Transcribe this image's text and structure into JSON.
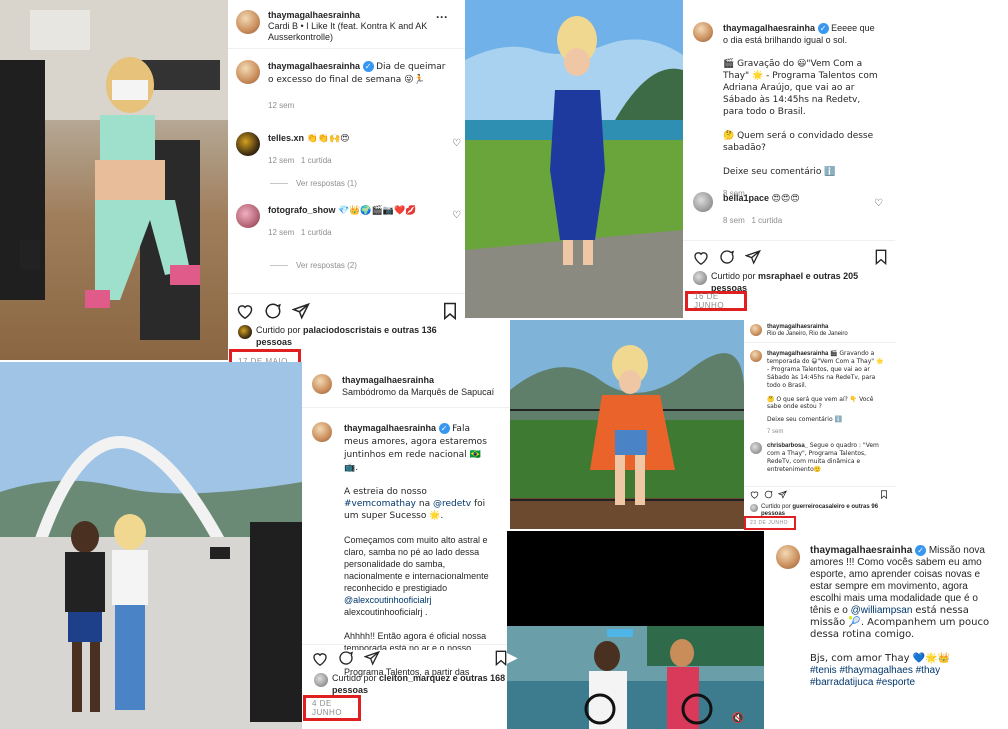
{
  "p1": {
    "username": "thaymagalhaesrainha",
    "audio": "Cardi B • I Like It (feat. Kontra K and AK Ausserkontrolle)",
    "caption": "Dia de queimar o excesso do final de semana 😜🏃",
    "caption_time": "12 sem",
    "c1_user": "telles.xn",
    "c1_text": "👏👏🙌😍",
    "c1_time": "12 sem",
    "c1_likes": "1 curtida",
    "c1_replies": "Ver respostas (1)",
    "c2_user": "fotografo_show",
    "c2_text": "💎👑🌍🎬📷❤️💋",
    "c2_time": "12 sem",
    "c2_likes": "1 curtida",
    "c2_replies": "Ver respostas (2)",
    "liked_prefix": "Curtido por",
    "liked_user": "palaciodoscristais",
    "liked_rest": "e outras 136 pessoas",
    "date": "17 DE MAIO"
  },
  "p2": {
    "username": "thaymagalhaesrainha",
    "caption": "Eeeee que o dia está brilhando igual o sol.",
    "caption_2": "🎬 Gravação do 😃\"Vem Com a Thay\" 🌟 - Programa Talentos com Adriana Araújo, que vai ao ar Sábado às 14:45hs na Redetv, para todo o Brasil.",
    "caption_3": "🤔 Quem será o convidado desse sabadão?",
    "caption_4": "Deixe seu comentário ℹ️",
    "caption_time": "8 sem",
    "c1_user": "bella1pace",
    "c1_text": "😍😍😍",
    "c1_time": "8 sem",
    "c1_likes": "1 curtida",
    "liked_prefix": "Curtido por",
    "liked_user": "msraphael",
    "liked_rest": "e outras 205 pessoas",
    "date": "16 DE JUNHO"
  },
  "p3": {
    "username": "thaymagalhaesrainha",
    "location": "Rio de Janeiro, Rio de Janeiro",
    "caption": "🎬 Gravando a temporada do 😃\"Vem Com a Thay\" 🌟 - Programa Talentos, que vai ao ar Sábado às 14:45hs na RedeTv, para todo o Brasil.",
    "caption_2": "🤔 O que será que vem aí? 👇 Você sabe onde estou ?",
    "caption_3": "Deixe seu comentário ℹ️",
    "caption_time": "7 sem",
    "c1_user": "chrisbarbosa_",
    "c1_text": "Segue o quadro : \"Vem com a Thay\", Programa Talentos, RedeTv, com muita dinâmica e entretenimento🙂",
    "liked_prefix": "Curtido por",
    "liked_user": "guerreirocasaleiro",
    "liked_rest": "e outras 96 pessoas",
    "date": "23 DE JUNHO"
  },
  "p4": {
    "username": "thaymagalhaesrainha",
    "location": "Sambódromo da Marquês de Sapucaí",
    "caption_1": "Fala meus amores, agora estaremos juntinhos em rede nacional 🇧🇷 📺.",
    "caption_2a": "A estreia do nosso",
    "caption_2_tag": "#vemcomathay",
    "caption_2b": "na",
    "caption_2_mention": "@redetv",
    "caption_2c": "foi um super Sucesso 🌟.",
    "caption_3": "Começamos com muito alto astral e claro, samba no pé ao lado dessa personalidade do samba, nacionalmente e internacionalmente reconhecido e prestigiado",
    "caption_3_mention": "@alexcoutinhooficialrj",
    "caption_3b": "alexcoutinhooficialrj .",
    "caption_4": "Ahhhh!! Então agora é oficial nossa temporada está no ar e o nosso encontro marcado todo Sábado, no Programa Talentos, a partir das",
    "liked_prefix": "Curtido por",
    "liked_user": "cleiton_marquez",
    "liked_rest": "e outras 168 pessoas",
    "date": "4 DE JUNHO"
  },
  "p5": {
    "username": "thaymagalhaesrainha",
    "caption_1": "Missão nova amores !!! Como vocês sabem eu amo esporte, amo aprender coisas novas e estar sempre em movimento, agora escolhi mais uma modalidade que é o tênis e o",
    "caption_mention": "@williampsan",
    "caption_2": "está nessa missão 🎾. Acompanhem um pouco dessa rotina comigo.",
    "caption_3": "Bjs, com amor Thay 💙🌟👑",
    "tags": "#tenis #thaymagalhaes #thay #barradatijuca #esporte"
  }
}
